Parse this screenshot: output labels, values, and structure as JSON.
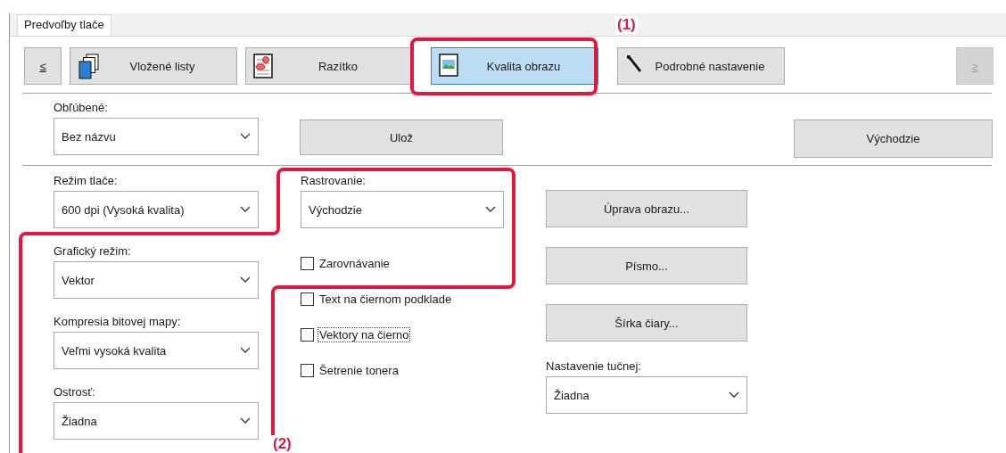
{
  "window_tab": {
    "label": "Predvoľby tlače",
    "selected": true
  },
  "nav_tabs": [
    {
      "kind": "arrow",
      "label": "≤",
      "selected": false,
      "disabled": false
    },
    {
      "kind": "tab",
      "label": "Vložené listy",
      "selected": false,
      "disabled": false
    },
    {
      "kind": "tab",
      "label": "Razítko",
      "selected": false,
      "disabled": false
    },
    {
      "kind": "tab",
      "label": "Kvalita obrazu",
      "selected": true,
      "disabled": false
    },
    {
      "kind": "tab",
      "label": "Podrobné nastavenie",
      "selected": false,
      "disabled": false
    },
    {
      "kind": "arrow",
      "label": "≥",
      "selected": false,
      "disabled": true
    }
  ],
  "favorites": {
    "label": "Obľúbené:",
    "value": "Bez názvu"
  },
  "save_button": "Ulož",
  "default_button": "Východzie",
  "left_fields": [
    {
      "label": "Režim tlače:",
      "value": "600 dpi (Vysoká kvalita)"
    },
    {
      "label": "Grafický režim:",
      "value": "Vektor"
    },
    {
      "label": "Kompresia bitovej mapy:",
      "value": "Veľmi vysoká kvalita"
    },
    {
      "label": "Ostrosť:",
      "value": "Žiadna"
    }
  ],
  "screening": {
    "label": "Rastrovanie:",
    "value": "Východzie"
  },
  "checkboxes": [
    {
      "label": "Zarovnávanie",
      "checked": false,
      "focused": false
    },
    {
      "label": "Text na čiernom podklade",
      "checked": false,
      "focused": false
    },
    {
      "label": "Vektory na čierno",
      "checked": false,
      "focused": true
    },
    {
      "label": "Šetrenie tonera",
      "checked": false,
      "focused": false
    }
  ],
  "right_buttons": [
    "Úprava obrazu...",
    "Písmo...",
    "Šírka čiary..."
  ],
  "bold_setting": {
    "label": "Nastavenie tučnej:",
    "value": "Žiadna"
  },
  "annotations": [
    {
      "label": "(1)"
    },
    {
      "label": "(2)"
    }
  ]
}
